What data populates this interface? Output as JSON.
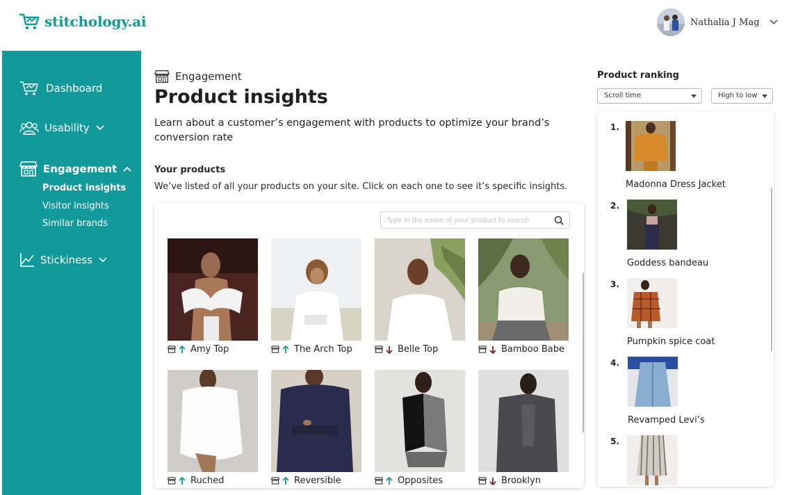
{
  "brand": {
    "name": "stitchology.ai",
    "color": "#12999a"
  },
  "user": {
    "name": "Nathalia J Mag"
  },
  "sidebar": {
    "items": [
      {
        "label": "Dashboard",
        "icon": "cart-chart-icon"
      },
      {
        "label": "Usability",
        "icon": "users-icon"
      },
      {
        "label": "Engagement",
        "icon": "store-icon",
        "expanded": true
      },
      {
        "label": "Stickiness",
        "icon": "line-chart-icon"
      }
    ],
    "engagement_sub": [
      "Product insights",
      "Visitor insights",
      "Similar brands"
    ]
  },
  "main": {
    "breadcrumb": "Engagement",
    "title": "Product insights",
    "description": "Learn about a customer’s engagement with products to optimize your brand’s conversion rate",
    "section_title": "Your products",
    "section_desc": "We’ve listed of all your products on your site. Click on each one to see it’s specific insights.",
    "search_placeholder": "Type in the name of your product to search",
    "products": [
      {
        "name": "Amy Top",
        "trend": "up"
      },
      {
        "name": "The Arch Top",
        "trend": "up"
      },
      {
        "name": "Belle Top",
        "trend": "down"
      },
      {
        "name": "Bamboo Babe",
        "trend": "down"
      },
      {
        "name": "Ruched",
        "trend": "up"
      },
      {
        "name": "Reversible",
        "trend": "up"
      },
      {
        "name": "Opposites",
        "trend": "up"
      },
      {
        "name": "Brooklyn",
        "trend": "down"
      }
    ],
    "trend_colors": {
      "up": "#12999a",
      "down": "#7a2020"
    }
  },
  "ranking": {
    "title": "Product ranking",
    "metric": "Scroll time",
    "order": "High to low",
    "items": [
      {
        "rank": "1.",
        "name": "Madonna Dress Jacket"
      },
      {
        "rank": "2.",
        "name": "Goddess bandeau"
      },
      {
        "rank": "3.",
        "name": "Pumpkin spice coat"
      },
      {
        "rank": "4.",
        "name": "Revamped Levi’s"
      },
      {
        "rank": "5.",
        "name": ""
      }
    ]
  }
}
